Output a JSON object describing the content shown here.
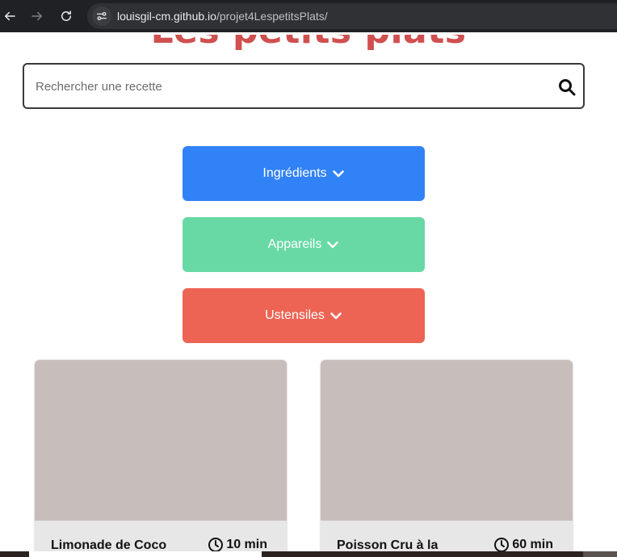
{
  "browser": {
    "url_host": "louisgil-cm.github.io",
    "url_path": "/projet4LespetitsPlats/"
  },
  "header": {
    "title": "Les petits plats"
  },
  "search": {
    "placeholder": "Rechercher une recette",
    "value": ""
  },
  "filters": {
    "ingredients_label": "Ingrédients",
    "appareils_label": "Appareils",
    "ustensiles_label": "Ustensiles",
    "colors": {
      "ingredients": "#3282f7",
      "appareils": "#68d9a4",
      "ustensiles": "#ed6454"
    }
  },
  "recipes": [
    {
      "title": "Limonade de Coco",
      "time": "10 min"
    },
    {
      "title": "Poisson Cru à la",
      "time": "60 min"
    }
  ],
  "icons": [
    "back-arrow-icon",
    "forward-arrow-icon",
    "reload-icon",
    "site-settings-icon",
    "search-icon",
    "chevron-down-icon",
    "clock-icon"
  ]
}
